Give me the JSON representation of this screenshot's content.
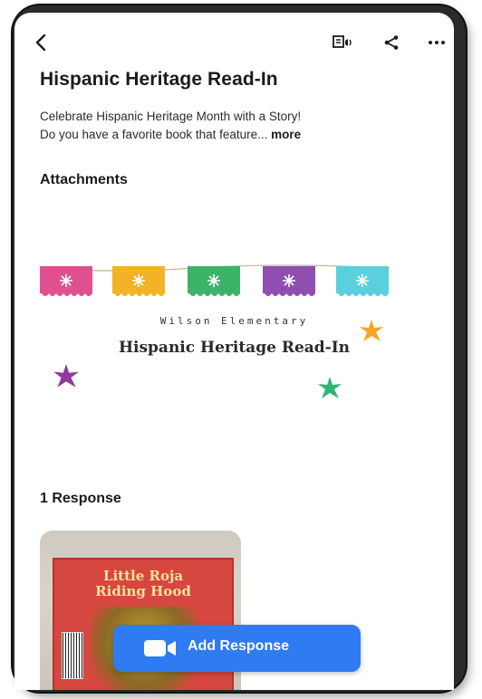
{
  "post": {
    "title": "Hispanic Heritage Read-In",
    "description_line1": "Celebrate Hispanic Heritage Month with a Story!",
    "description_line2": "Do you have a favorite book that feature...",
    "more_label": "more"
  },
  "attachments": {
    "heading": "Attachments",
    "school_name": "Wilson Elementary",
    "event_title": "Hispanic Heritage Read-In",
    "flag_colors": [
      "#e0508f",
      "#f3b325",
      "#3bb46a",
      "#8e4fb0",
      "#5ad0de"
    ],
    "star_colors": [
      "#f5a623",
      "#8e3a9a",
      "#2bb673"
    ]
  },
  "responses": {
    "heading": "1 Response",
    "book_title_line1": "Little Roja",
    "book_title_line2": "Riding Hood"
  },
  "actions": {
    "add_response_label": "Add Response",
    "accent": "#2f7bf2"
  },
  "icons": {
    "back": "back-arrow-icon",
    "immersive_reader": "immersive-reader-icon",
    "share": "share-icon",
    "more": "more-options-icon",
    "camera": "video-camera-icon"
  }
}
